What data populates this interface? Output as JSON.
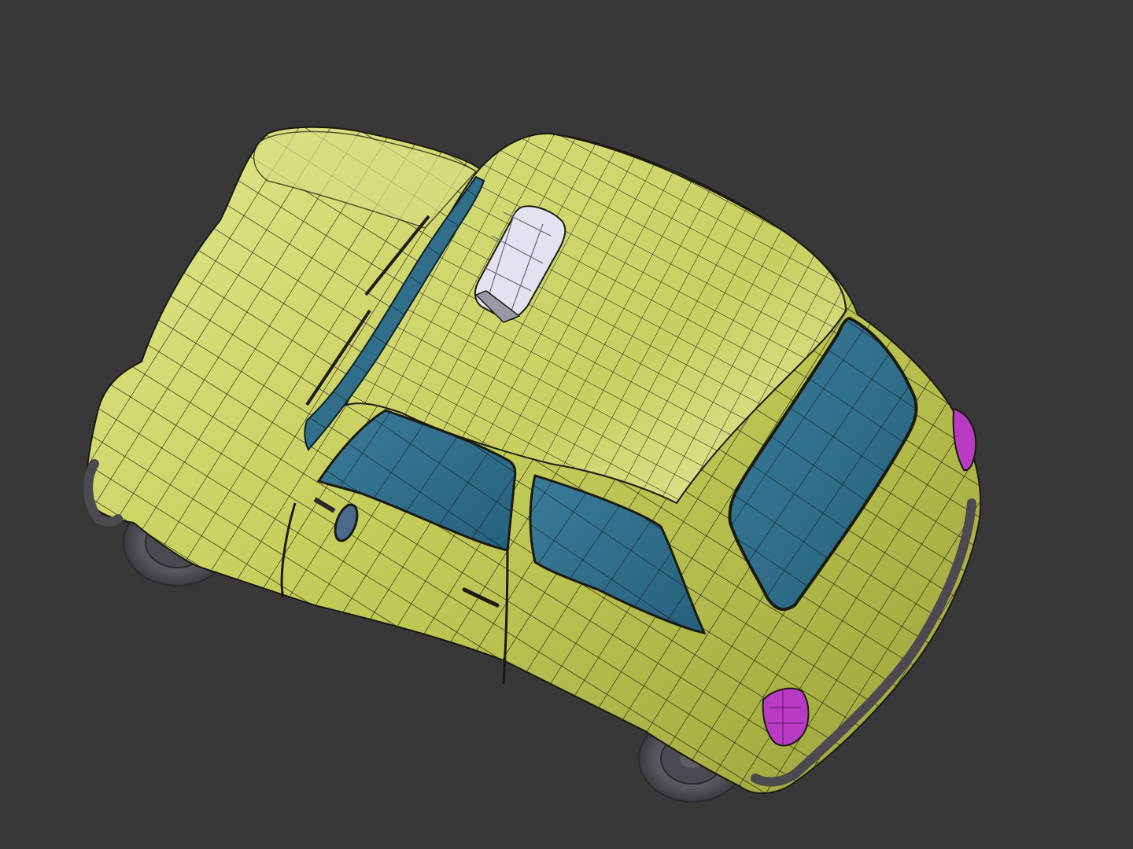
{
  "viewport": {
    "background_color": "#383838",
    "render_mode": "shaded-with-wireframe"
  },
  "model": {
    "subject": "compact-taxi-car",
    "view": "top-three-quarter",
    "colors": {
      "body": "#C6CE5A",
      "body_highlight": "#E8EC9A",
      "body_shadow": "#8C9430",
      "glass": "#2F6E8A",
      "glass_light": "#4A8FAD",
      "taxi_sign": "#D9D6E8",
      "tail_light": "#B93BC4",
      "tire": "#5A5A60",
      "wire": "#1A1A10"
    },
    "parts": [
      "roof",
      "hood",
      "windshield",
      "side-window-front",
      "side-window-rear",
      "rear-window",
      "taxi-roof-sign",
      "side-mirror",
      "door-handle",
      "tail-light",
      "front-wheel",
      "rear-wheel",
      "bumper-rear",
      "bumper-front"
    ]
  }
}
